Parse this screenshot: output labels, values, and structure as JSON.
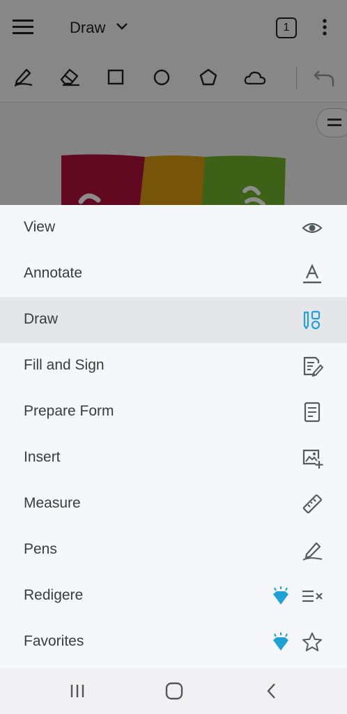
{
  "header": {
    "mode_title": "Draw",
    "page_count": "1"
  },
  "document": {
    "banner_colors": [
      "#b3123f",
      "#d79a12",
      "#6fb32b"
    ]
  },
  "menu": {
    "items": [
      {
        "label": "View",
        "icon": "eye-icon"
      },
      {
        "label": "Annotate",
        "icon": "text-a-icon"
      },
      {
        "label": "Draw",
        "icon": "draw-shapes-icon",
        "selected": true
      },
      {
        "label": "Fill and Sign",
        "icon": "fill-sign-icon"
      },
      {
        "label": "Prepare Form",
        "icon": "form-icon"
      },
      {
        "label": "Insert",
        "icon": "insert-image-icon"
      },
      {
        "label": "Measure",
        "icon": "ruler-icon"
      },
      {
        "label": "Pens",
        "icon": "pen-icon"
      },
      {
        "label": "Redigere",
        "icon": "redact-icon",
        "premium": true
      },
      {
        "label": "Favorites",
        "icon": "star-icon",
        "premium": true
      }
    ]
  },
  "colors": {
    "accent": "#1fa1d6",
    "icon_gray": "#555a60",
    "text": "#3b3b3b"
  }
}
